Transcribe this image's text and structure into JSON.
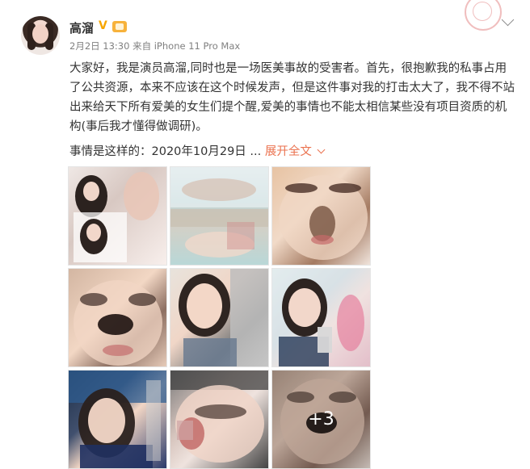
{
  "header": {
    "username": "高溜",
    "meta": "2月2日 13:30 来自 iPhone 11 Pro Max"
  },
  "post": {
    "text": "大家好，我是演员高溜,同时也是一场医美事故的受害者。首先，很抱歉我的私事占用了公共资源，本来不应该在这个时候发声，但是这件事对我的打击太大了，我不得不站出来给天下所有爱美的女生们提个醒,爱美的事情也不能太相信某些没有项目资质的机构(事后我才懂得做调研)。",
    "more_prefix": "事情是这样的：2020年10月29日 ...",
    "expand_label": "展开全文"
  },
  "gallery": {
    "more_count": "+3"
  },
  "colors": {
    "accent": "#eb7350",
    "text": "#333333",
    "muted": "#808080"
  }
}
